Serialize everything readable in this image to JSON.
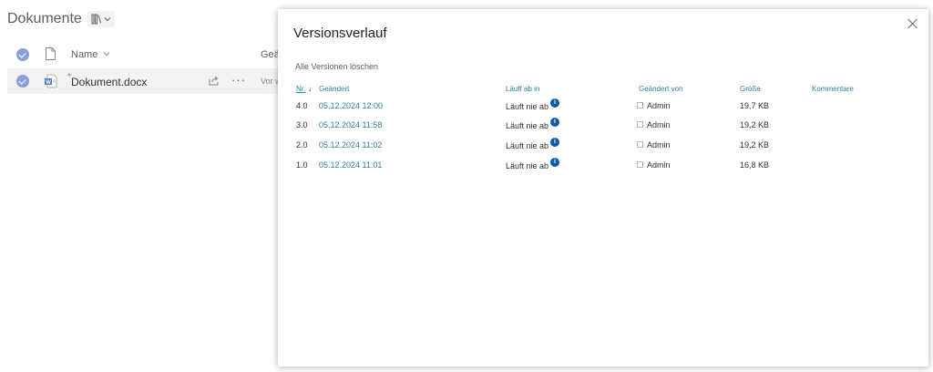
{
  "library": {
    "title": "Dokumente",
    "columns": {
      "name": "Name",
      "modified_partial": "Geän"
    },
    "file": {
      "name": "Dokument.docx",
      "more": "···",
      "modified_partial": "Vor w"
    },
    "icons": [
      "check-circle-icon",
      "document-icon",
      "library-view-icon",
      "chevron-down-icon",
      "word-file-icon",
      "share-icon",
      "more-icon"
    ]
  },
  "dialog": {
    "title": "Versionsverlauf",
    "delete_all": "Alle Versionen löschen",
    "columns": {
      "nr": "Nr.",
      "sort_arrow": "↓",
      "modified": "Geändert",
      "expires": "Läuft ab in",
      "modified_by": "Geändert von",
      "size": "Größe",
      "comments": "Kommentare"
    },
    "versions": [
      {
        "nr": "4.0",
        "date": "05.12.2024 12:00",
        "expires": "Läuft nie ab",
        "user": "Admin",
        "size": "19,7 KB"
      },
      {
        "nr": "3.0",
        "date": "05.12.2024 11:58",
        "expires": "Läuft nie ab",
        "user": "Admin",
        "size": "19,2 KB"
      },
      {
        "nr": "2.0",
        "date": "05.12.2024 11:02",
        "expires": "Läuft nie ab",
        "user": "Admin",
        "size": "19,2 KB"
      },
      {
        "nr": "1.0",
        "date": "05.12.2024 11:01",
        "expires": "Läuft nie ab",
        "user": "Admin",
        "size": "16,8 KB"
      }
    ],
    "info_glyph": "i"
  },
  "colors": {
    "accent_link": "#2e7f99",
    "info_blue": "#0a5ba8",
    "selected_row": "#f3f2f1",
    "check_circle": "#8a9fd6"
  }
}
